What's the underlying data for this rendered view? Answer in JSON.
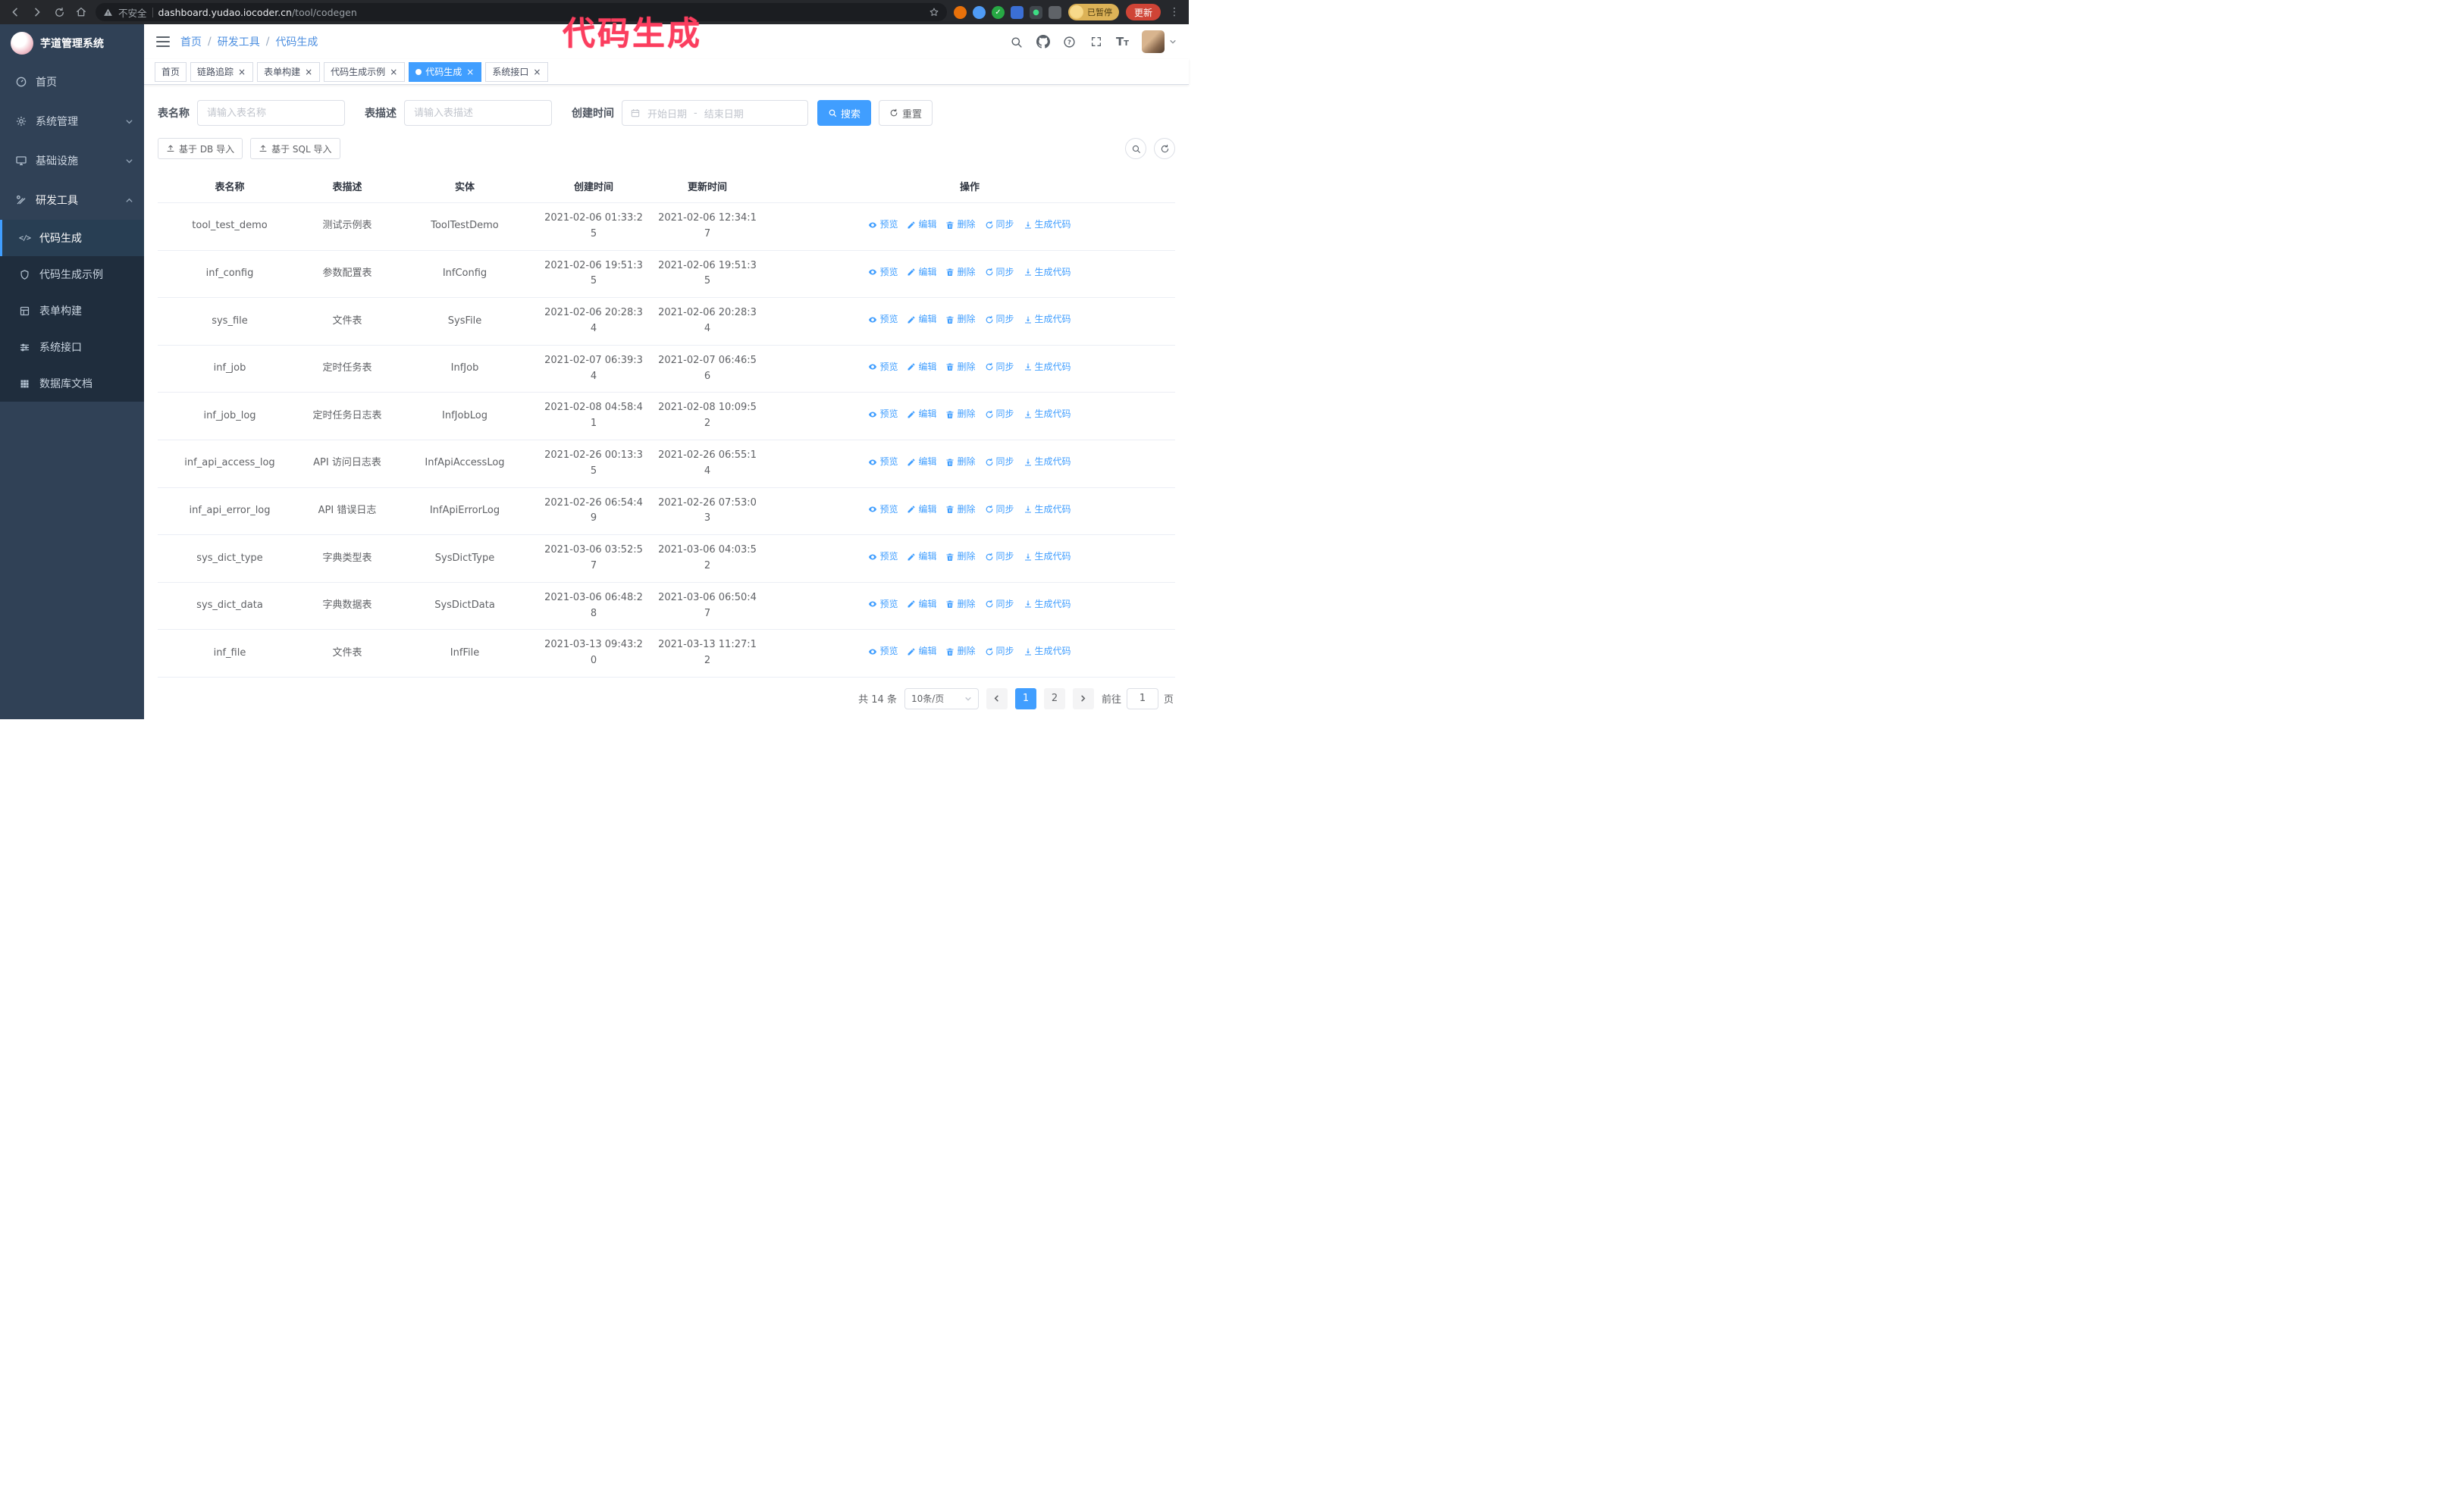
{
  "colors": {
    "accent": "#409eff",
    "sidebar_bg": "#304156",
    "annotation": "#fb3d5e"
  },
  "annotation": "代码生成",
  "browser": {
    "security_label": "不安全",
    "url_domain": "dashboard.yudao.iocoder.cn",
    "url_path": "/tool/codegen",
    "paused_badge": "已暂停",
    "update_button": "更新"
  },
  "sidebar": {
    "logo_title": "芋道管理系统",
    "items": [
      {
        "label": "首页"
      },
      {
        "label": "系统管理"
      },
      {
        "label": "基础设施"
      },
      {
        "label": "研发工具"
      }
    ],
    "sub_items": [
      {
        "label": "代码生成"
      },
      {
        "label": "代码生成示例"
      },
      {
        "label": "表单构建"
      },
      {
        "label": "系统接口"
      },
      {
        "label": "数据库文档"
      }
    ]
  },
  "topbar": {
    "breadcrumb": [
      "首页",
      "研发工具",
      "代码生成"
    ]
  },
  "tabs": [
    {
      "label": "首页",
      "closable": false,
      "active": false
    },
    {
      "label": "链路追踪",
      "closable": true,
      "active": false
    },
    {
      "label": "表单构建",
      "closable": true,
      "active": false
    },
    {
      "label": "代码生成示例",
      "closable": true,
      "active": false
    },
    {
      "label": "代码生成",
      "closable": true,
      "active": true
    },
    {
      "label": "系统接口",
      "closable": true,
      "active": false
    }
  ],
  "filters": {
    "table_name_label": "表名称",
    "table_name_placeholder": "请输入表名称",
    "table_desc_label": "表描述",
    "table_desc_placeholder": "请输入表描述",
    "create_time_label": "创建时间",
    "date_start_placeholder": "开始日期",
    "date_separator": "-",
    "date_end_placeholder": "结束日期",
    "search_button": "搜索",
    "reset_button": "重置"
  },
  "toolbar": {
    "import_db_label": "基于 DB 导入",
    "import_sql_label": "基于 SQL 导入"
  },
  "table": {
    "columns": [
      "表名称",
      "表描述",
      "实体",
      "创建时间",
      "更新时间",
      "操作"
    ],
    "action_labels": [
      "预览",
      "编辑",
      "删除",
      "同步",
      "生成代码"
    ],
    "action_icons": [
      "eye-icon",
      "edit-icon",
      "delete-icon",
      "sync-icon",
      "download-icon"
    ],
    "rows": [
      {
        "name": "tool_test_demo",
        "desc": "测试示例表",
        "entity": "ToolTestDemo",
        "created": "2021-02-06 01:33:25",
        "updated": "2021-02-06 12:34:17"
      },
      {
        "name": "inf_config",
        "desc": "参数配置表",
        "entity": "InfConfig",
        "created": "2021-02-06 19:51:35",
        "updated": "2021-02-06 19:51:35"
      },
      {
        "name": "sys_file",
        "desc": "文件表",
        "entity": "SysFile",
        "created": "2021-02-06 20:28:34",
        "updated": "2021-02-06 20:28:34"
      },
      {
        "name": "inf_job",
        "desc": "定时任务表",
        "entity": "InfJob",
        "created": "2021-02-07 06:39:34",
        "updated": "2021-02-07 06:46:56"
      },
      {
        "name": "inf_job_log",
        "desc": "定时任务日志表",
        "entity": "InfJobLog",
        "created": "2021-02-08 04:58:41",
        "updated": "2021-02-08 10:09:52"
      },
      {
        "name": "inf_api_access_log",
        "desc": "API 访问日志表",
        "entity": "InfApiAccessLog",
        "created": "2021-02-26 00:13:35",
        "updated": "2021-02-26 06:55:14"
      },
      {
        "name": "inf_api_error_log",
        "desc": "API 错误日志",
        "entity": "InfApiErrorLog",
        "created": "2021-02-26 06:54:49",
        "updated": "2021-02-26 07:53:03"
      },
      {
        "name": "sys_dict_type",
        "desc": "字典类型表",
        "entity": "SysDictType",
        "created": "2021-03-06 03:52:57",
        "updated": "2021-03-06 04:03:52"
      },
      {
        "name": "sys_dict_data",
        "desc": "字典数据表",
        "entity": "SysDictData",
        "created": "2021-03-06 06:48:28",
        "updated": "2021-03-06 06:50:47"
      },
      {
        "name": "inf_file",
        "desc": "文件表",
        "entity": "InfFile",
        "created": "2021-03-13 09:43:20",
        "updated": "2021-03-13 11:27:12"
      }
    ]
  },
  "pagination": {
    "total_label": "共 14 条",
    "page_size_label": "10条/页",
    "pages": [
      "1",
      "2"
    ],
    "active_page": "1",
    "goto_label": "前往",
    "goto_value": "1",
    "goto_unit": "页"
  }
}
